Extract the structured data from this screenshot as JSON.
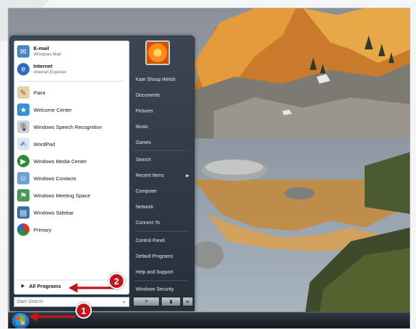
{
  "start_menu": {
    "pinned": [
      {
        "name": "E-mail",
        "sub": "Windows Mail",
        "icon": "mail-icon"
      },
      {
        "name": "Internet",
        "sub": "Internet Explorer",
        "icon": "internet-explorer-icon"
      }
    ],
    "recent": [
      {
        "label": "Paint",
        "icon": "paint-icon"
      },
      {
        "label": "Welcome Center",
        "icon": "welcome-center-icon"
      },
      {
        "label": "Windows Speech Recognition",
        "icon": "microphone-icon"
      },
      {
        "label": "WordPad",
        "icon": "wordpad-icon"
      },
      {
        "label": "Windows Media Center",
        "icon": "media-center-icon"
      },
      {
        "label": "Windows Contacts",
        "icon": "contacts-icon"
      },
      {
        "label": "Windows Meeting Space",
        "icon": "meeting-space-icon"
      },
      {
        "label": "Windows Sidebar",
        "icon": "sidebar-icon"
      },
      {
        "label": "Primary",
        "icon": "pie-chart-icon"
      }
    ],
    "all_programs": "All Programs",
    "search_placeholder": "Start Search",
    "right_items": {
      "user": "Kate Shoup Welsh",
      "documents": "Documents",
      "pictures": "Pictures",
      "music": "Music",
      "games": "Games",
      "search": "Search",
      "recent_items": "Recent Items",
      "computer": "Computer",
      "network": "Network",
      "connect_to": "Connect To",
      "control_panel": "Control Panel",
      "default_programs": "Default Programs",
      "help_support": "Help and Support",
      "windows_security": "Windows Security"
    }
  },
  "callouts": {
    "one": "1",
    "two": "2"
  },
  "colors": {
    "callout_red": "#c0161e",
    "menu_dark": "#26303a"
  }
}
